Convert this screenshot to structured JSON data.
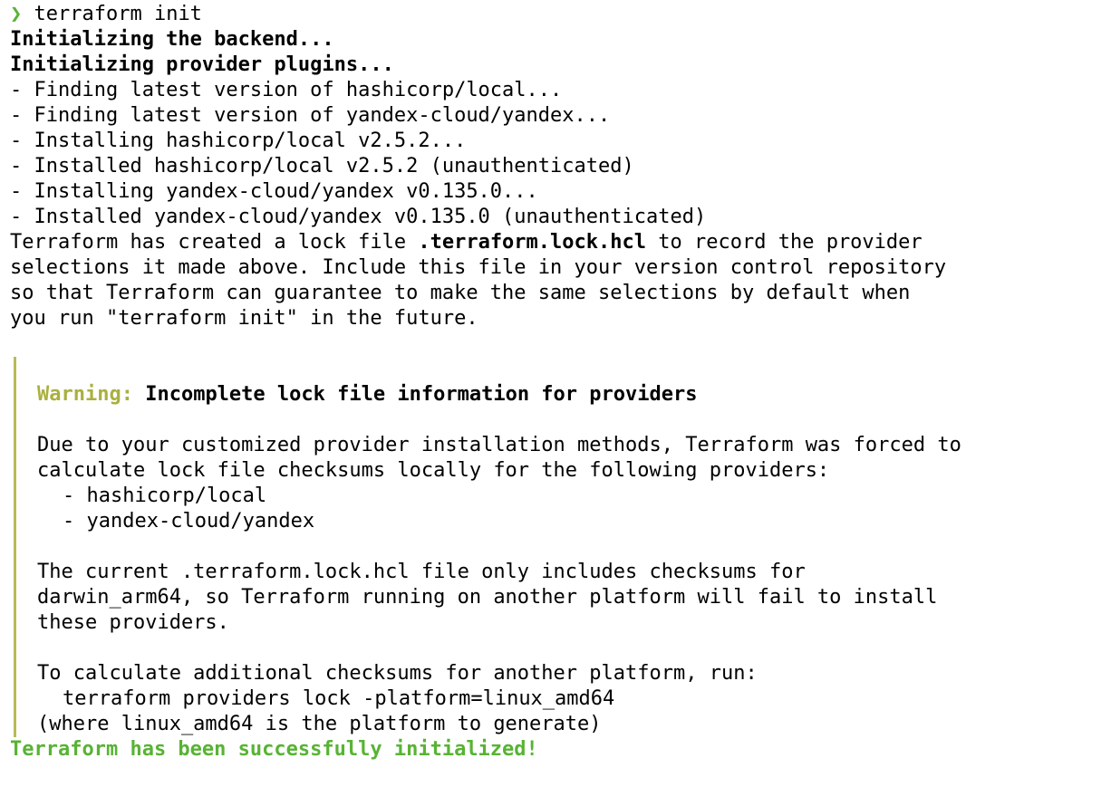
{
  "prompt": {
    "glyph": "❯",
    "command": "terraform init"
  },
  "backend_line": "Initializing the backend...",
  "plugins_line": "Initializing provider plugins...",
  "install_steps": [
    "- Finding latest version of hashicorp/local...",
    "- Finding latest version of yandex-cloud/yandex...",
    "- Installing hashicorp/local v2.5.2...",
    "- Installed hashicorp/local v2.5.2 (unauthenticated)",
    "- Installing yandex-cloud/yandex v0.135.0...",
    "- Installed yandex-cloud/yandex v0.135.0 (unauthenticated)"
  ],
  "lock_note": {
    "prefix": "Terraform has created a lock file ",
    "filename": ".terraform.lock.hcl",
    "suffix": " to record the provider",
    "line2": "selections it made above. Include this file in your version control repository",
    "line3": "so that Terraform can guarantee to make the same selections by default when",
    "line4": "you run \"terraform init\" in the future."
  },
  "warning": {
    "label": "Warning:",
    "title": " Incomplete lock file information for providers",
    "para1_line1": "Due to your customized provider installation methods, Terraform was forced to",
    "para1_line2": "calculate lock file checksums locally for the following providers:",
    "providers": [
      "- hashicorp/local",
      "- yandex-cloud/yandex"
    ],
    "para2_line1": "The current .terraform.lock.hcl file only includes checksums for",
    "para2_line2": "darwin_arm64, so Terraform running on another platform will fail to install",
    "para2_line3": "these providers.",
    "para3_line1": "To calculate additional checksums for another platform, run:",
    "para3_command": "terraform providers lock -platform=linux_amd64",
    "para3_line3": "(where linux_amd64 is the platform to generate)"
  },
  "success_line": "Terraform has been successfully initialized!",
  "colors": {
    "prompt": "#58b335",
    "warning_label": "#aab040",
    "warning_bar": "#b7bb57",
    "success": "#58b335"
  }
}
